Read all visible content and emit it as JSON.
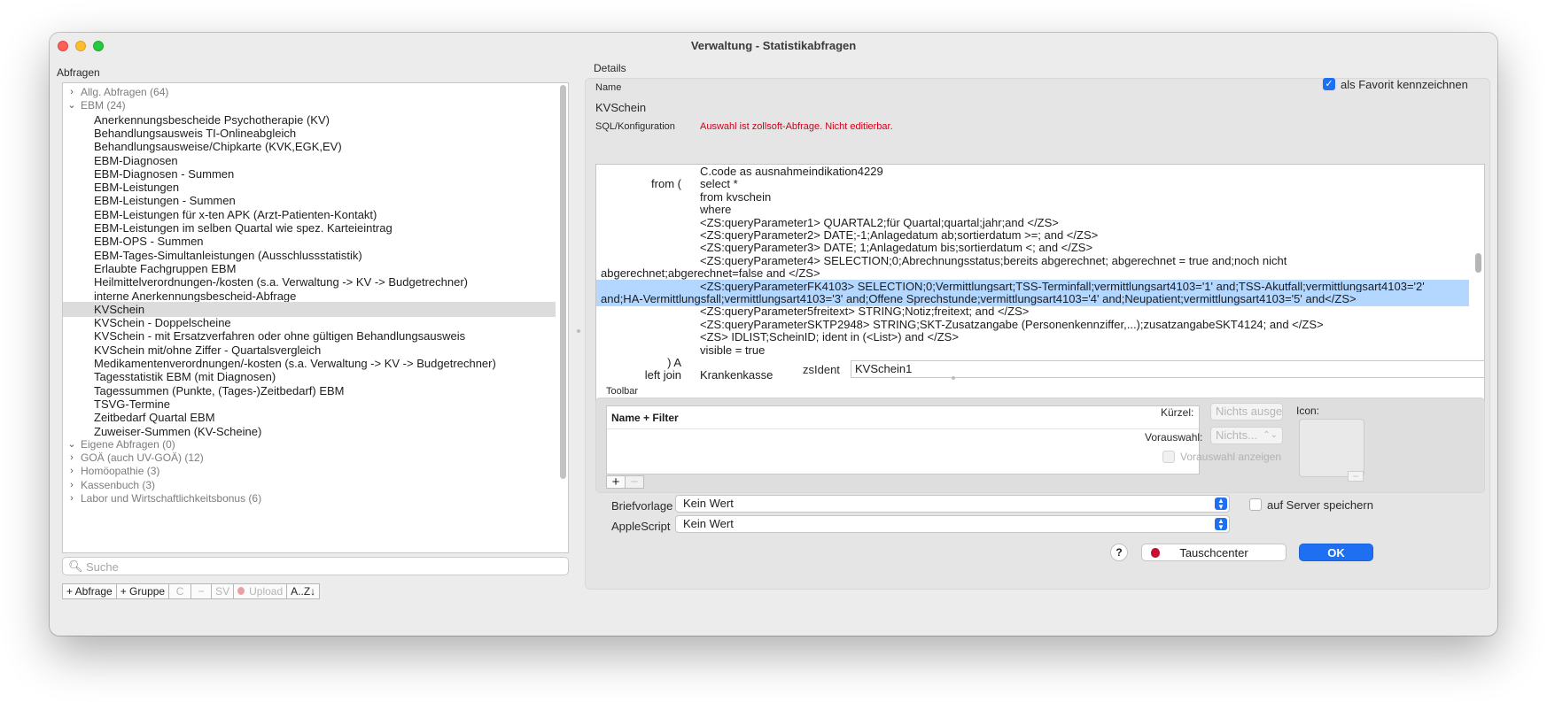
{
  "window": {
    "title": "Verwaltung - Statistikabfragen"
  },
  "left": {
    "label": "Abfragen",
    "tree": [
      {
        "type": "group",
        "expanded": false,
        "label": "Allg. Abfragen (64)"
      },
      {
        "type": "group",
        "expanded": true,
        "label": "EBM (24)"
      },
      {
        "type": "item",
        "label": "Anerkennungsbescheide Psychotherapie (KV)"
      },
      {
        "type": "item",
        "label": "Behandlungsausweis TI-Onlineabgleich"
      },
      {
        "type": "item",
        "label": "Behandlungsausweise/Chipkarte (KVK,EGK,EV)"
      },
      {
        "type": "item",
        "label": "EBM-Diagnosen"
      },
      {
        "type": "item",
        "label": "EBM-Diagnosen - Summen"
      },
      {
        "type": "item",
        "label": "EBM-Leistungen"
      },
      {
        "type": "item",
        "label": "EBM-Leistungen - Summen"
      },
      {
        "type": "item",
        "label": "EBM-Leistungen für x-ten APK (Arzt-Patienten-Kontakt)"
      },
      {
        "type": "item",
        "label": "EBM-Leistungen im selben Quartal wie spez. Karteieintrag"
      },
      {
        "type": "item",
        "label": "EBM-OPS - Summen"
      },
      {
        "type": "item",
        "label": "EBM-Tages-Simultanleistungen (Ausschlussstatistik)"
      },
      {
        "type": "item",
        "label": "Erlaubte Fachgruppen EBM"
      },
      {
        "type": "item",
        "label": "Heilmittelverordnungen-/kosten (s.a. Verwaltung -> KV -> Budgetrechner)"
      },
      {
        "type": "item",
        "label": "interne Anerkennungsbescheid-Abfrage"
      },
      {
        "type": "item",
        "label": "KVSchein",
        "selected": true
      },
      {
        "type": "item",
        "label": "KVSchein - Doppelscheine"
      },
      {
        "type": "item",
        "label": "KVSchein - mit Ersatzverfahren oder ohne gültigen Behandlungsausweis"
      },
      {
        "type": "item",
        "label": "KVSchein mit/ohne Ziffer - Quartalsvergleich"
      },
      {
        "type": "item",
        "label": "Medikamentenverordnungen/-kosten (s.a. Verwaltung -> KV -> Budgetrechner)"
      },
      {
        "type": "item",
        "label": "Tagesstatistik EBM (mit Diagnosen)"
      },
      {
        "type": "item",
        "label": "Tagessummen (Punkte, (Tages-)Zeitbedarf) EBM"
      },
      {
        "type": "item",
        "label": "TSVG-Termine"
      },
      {
        "type": "item",
        "label": "Zeitbedarf Quartal EBM"
      },
      {
        "type": "item",
        "label": "Zuweiser-Summen (KV-Scheine)"
      },
      {
        "type": "group",
        "expanded": true,
        "label": "Eigene Abfragen (0)"
      },
      {
        "type": "group",
        "expanded": false,
        "label": "GOÄ (auch UV-GOÄ) (12)"
      },
      {
        "type": "group",
        "expanded": false,
        "label": "Homöopathie (3)"
      },
      {
        "type": "group",
        "expanded": false,
        "label": "Kassenbuch (3)"
      },
      {
        "type": "group",
        "expanded": false,
        "label": "Labor und Wirtschaftlichkeitsbonus (6)"
      }
    ],
    "search_placeholder": "Suche",
    "buttons": {
      "add_query": "+ Abfrage",
      "add_group": "+ Gruppe",
      "c": "C",
      "minus": "−",
      "sv": "SV",
      "upload": "Upload",
      "sort": "A..Z↓"
    }
  },
  "details": {
    "label": "Details",
    "name_label": "Name",
    "name_value": "KVSchein",
    "favorite_label": "als Favorit kennzeichnen",
    "favorite_checked": true,
    "sql_label": "SQL/Konfiguration",
    "readonly_warning": "Auswahl ist zollsoft-Abfrage. Nicht editierbar.",
    "sql_lines": [
      {
        "kw": "",
        "text": "C.code as ausnahmeindikation4229"
      },
      {
        "kw": "from (",
        "text": "select *"
      },
      {
        "kw": "",
        "text": "from kvschein"
      },
      {
        "kw": "",
        "text": "where"
      },
      {
        "kw": "",
        "text": "<ZS:queryParameter1> QUARTAL2;für Quartal;quartal;jahr;and </ZS>"
      },
      {
        "kw": "",
        "text": "<ZS:queryParameter2> DATE;-1;Anlagedatum ab;sortierdatum >=; and </ZS>"
      },
      {
        "kw": "",
        "text": "<ZS:queryParameter3> DATE; 1;Anlagedatum bis;sortierdatum <; and </ZS>"
      },
      {
        "kw": "",
        "text": "<ZS:queryParameter4> SELECTION;0;Abrechnungsstatus;bereits abgerechnet; abgerechnet = true and;noch nicht"
      },
      {
        "full": "abgerechnet;abgerechnet=false and </ZS>"
      },
      {
        "kw": "",
        "text": "<ZS:queryParameterFK4103> SELECTION;0;Vermittlungsart;TSS-Terminfall;vermittlungsart4103='1' and;TSS-Akutfall;vermittlungsart4103='2'",
        "hl": true
      },
      {
        "full": "and;HA-Vermittlungsfall;vermittlungsart4103='3' and;Offene Sprechstunde;vermittlungsart4103='4' and;Neupatient;vermittlungsart4103='5' and</ZS>",
        "hl": true
      },
      {
        "kw": "",
        "text": "<ZS:queryParameter5freitext> STRING;Notiz;freitext; and </ZS>"
      },
      {
        "kw": "",
        "text": "<ZS:queryParameterSKTP2948> STRING;SKT-Zusatzangabe (Personenkennziffer,...);zusatzangabeSKT4124; and </ZS>"
      },
      {
        "kw": "",
        "text": "<ZS> IDLIST;ScheinID; ident in (<List>) and </ZS>"
      },
      {
        "kw": "",
        "text": "visible = true"
      },
      {
        "kw": ") A",
        "text": ""
      },
      {
        "kw": "left join",
        "text": "Krankenkasse"
      }
    ],
    "zsident_label": "zsIdent",
    "zsident_value": "KVSchein1"
  },
  "toolbar": {
    "label": "Toolbar",
    "table_header": "Name + Filter",
    "kuerzel_label": "Kürzel:",
    "kuerzel_placeholder": "Nichts ausgewählt",
    "vorauswahl_label": "Vorauswahl:",
    "vorauswahl_value": "Nichts...",
    "vorauswahl_anzeigen": "Vorauswahl anzeigen",
    "icon_label": "Icon:",
    "plus": "+",
    "minus": "−"
  },
  "footer": {
    "briefvorlage_label": "Briefvorlage",
    "briefvorlage_value": "Kein Wert",
    "applescript_label": "AppleScript",
    "applescript_value": "Kein Wert",
    "server_label": "auf Server speichern",
    "help": "?",
    "tauschcenter": "Tauschcenter",
    "ok": "OK"
  },
  "colors": {
    "accent": "#1e6ff1",
    "warning": "#d0021b",
    "selection_row": "#dcdcdc",
    "text_highlight": "#b3d7ff"
  }
}
